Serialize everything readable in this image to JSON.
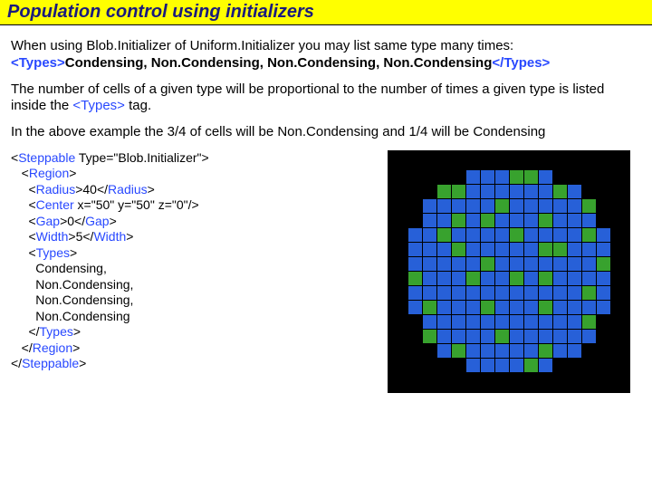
{
  "title": "Population control using initializers",
  "para1_pre": "When using Blob.Initializer of Uniform.Initializer you may list same type many times:",
  "para1_open": "<Types>",
  "para1_body": "Condensing, Non.Condensing, Non.Condensing, Non.Condensing",
  "para1_close": "</Types>",
  "para2_a": "The number of cells of a given type will be proportional to the number of times a given type is listed inside the ",
  "para2_tag": "<Types>",
  "para2_b": " tag.",
  "para3": "In the above example the 3/4 of cells will be Non.Condensing and 1/4 will be Condensing",
  "code": {
    "l01a": "<",
    "l01b": "Steppable",
    "l01c": " Type=\"Blob.Initializer\">",
    "l02a": "   <",
    "l02b": "Region",
    "l02c": ">",
    "l03a": "     <",
    "l03b": "Radius",
    "l03c": ">40</",
    "l03d": "Radius",
    "l03e": ">",
    "l04a": "     <",
    "l04b": "Center",
    "l04c": " x=\"50\" y=\"50\" z=\"0\"/>",
    "l05a": "     <",
    "l05b": "Gap",
    "l05c": ">0</",
    "l05d": "Gap",
    "l05e": ">",
    "l06a": "     <",
    "l06b": "Width",
    "l06c": ">5</",
    "l06d": "Width",
    "l06e": ">",
    "l07a": "     <",
    "l07b": "Types",
    "l07c": ">",
    "l08": "       Condensing,",
    "l09": "       Non.Condensing,",
    "l10": "       Non.Condensing,",
    "l11": "       Non.Condensing",
    "l12a": "     </",
    "l12b": "Types",
    "l12c": ">",
    "l13a": "   </",
    "l13b": "Region",
    "l13c": ">",
    "l14a": "</",
    "l14b": "Steppable",
    "l14c": ">"
  },
  "chart_data": {
    "type": "grid",
    "legend": {
      "green": "Condensing",
      "blue": "Non.Condensing",
      "black": "empty"
    },
    "ratio": {
      "Condensing": 0.25,
      "Non.Condensing": 0.75
    },
    "rows": [
      "................",
      ".....bbbggb.....",
      "...ggbbbbbbgb...",
      "..bbbbbgbbbbbg..",
      "..bbgbgbbbgbbb..",
      ".bbgbbbbgbbbbgb.",
      ".bbbgbbbbbggbbb.",
      ".bbbbbgbbbbbbbg.",
      ".gbbbgbbgbgbbbb.",
      ".bbbbbbbbbbbbgb.",
      ".bgbbbgbbbgbbbb.",
      "..bbbbbbbbbbbg..",
      "..gbbbbgbbbbbb..",
      "...bgbbbbbgbb...",
      ".....bbbbgb.....",
      "................"
    ]
  }
}
